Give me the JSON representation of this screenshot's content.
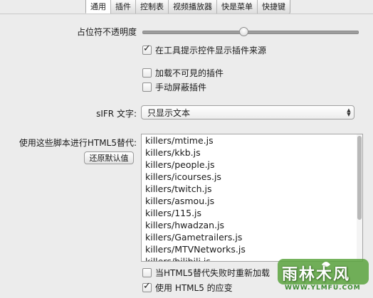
{
  "tabs": [
    "通用",
    "插件",
    "控制表",
    "视频播放器",
    "快是菜单",
    "快捷键"
  ],
  "active_tab_index": 0,
  "opacity": {
    "label": "占位符不透明度",
    "value_fraction": 0.47
  },
  "checkboxes": {
    "show_plugin_source": {
      "label": "在工具提示控件显示插件来源",
      "checked": true
    },
    "load_invisible": {
      "label": "加载不可見的插件",
      "checked": false
    },
    "manual_block": {
      "label": "手动屏蔽插件",
      "checked": false
    },
    "reload_on_fail": {
      "label": "当HTML5替代失败时重新加载",
      "checked": false
    },
    "use_html5": {
      "label": "使用 HTML5 的应变",
      "checked": true
    }
  },
  "sifr": {
    "label": "sIFR 文字:",
    "selected": "只显示文本"
  },
  "scripts": {
    "label": "使用这些脚本进行HTML5替代:",
    "reset_button": "还原默认值",
    "items": [
      "killers/mtime.js",
      "killers/kkb.js",
      "killers/people.js",
      "killers/icourses.js",
      "killers/twitch.js",
      "killers/asmou.js",
      "killers/115.js",
      "killers/hwadzan.js",
      "killers/Gametrailers.js",
      "killers/MTVNetworks.js",
      "killers/bilibili.js"
    ]
  },
  "watermark": {
    "text": "雨林木风",
    "url": "WWW.YLMFU.COM"
  }
}
